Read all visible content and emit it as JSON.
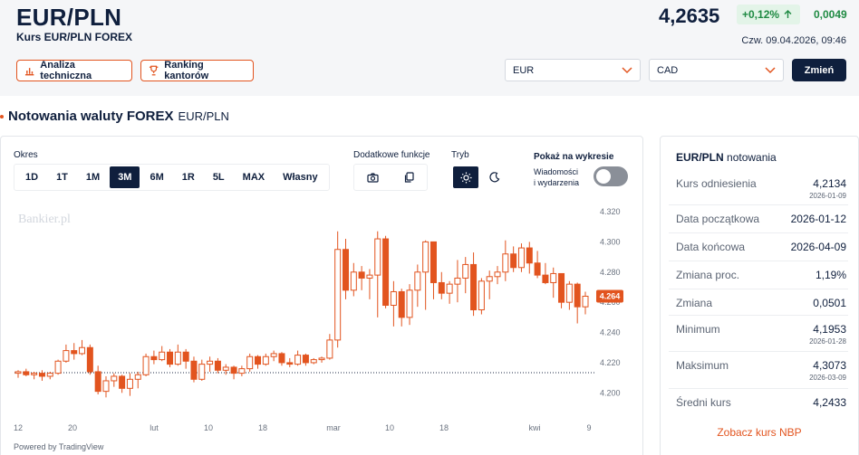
{
  "header": {
    "title": "EUR/PLN",
    "subtitle": "Kurs EUR/PLN FOREX",
    "rate": "4,2635",
    "change_pct": "+0,12%",
    "change_abs": "0,0049",
    "datetime": "Czw. 09.04.2026, 09:46",
    "buttons": {
      "analysis": "Analiza techniczna",
      "ranking": "Ranking kantorów",
      "change": "Zmień"
    },
    "select_from": "EUR",
    "select_to": "CAD",
    "colors": {
      "accent": "#e2541f",
      "navy": "#0f1f3d",
      "positive": "#1f8a43"
    }
  },
  "section": {
    "title": "Notowania waluty FOREX",
    "pair": "EUR/PLN"
  },
  "controls": {
    "okres_label": "Okres",
    "periods": [
      "1D",
      "1T",
      "1M",
      "3M",
      "6M",
      "1R",
      "5L",
      "MAX",
      "Własny"
    ],
    "active_period": "3M",
    "functions_label": "Dodatkowe funkcje",
    "functions": [
      "camera-icon",
      "copy-icon"
    ],
    "mode_label": "Tryb",
    "modes": [
      "sun-icon",
      "moon-icon"
    ],
    "show_label": "Pokaż na wykresie",
    "toggle_label_1": "Wiadomości",
    "toggle_label_2": "i wydarzenia",
    "toggle_on": false
  },
  "chart_data": {
    "type": "candlestick",
    "watermark": "Bankier.pl",
    "powered_by": "Powered by TradingView",
    "ylim": [
      4.193,
      4.326
    ],
    "y_ticks": [
      "4.320",
      "4.300",
      "4.280",
      "4.260",
      "4.240",
      "4.220",
      "4.200"
    ],
    "x_ticks": [
      "12",
      "20",
      "lut",
      "10",
      "18",
      "mar",
      "10",
      "18",
      "kwi",
      "9"
    ],
    "reference_line": 4.2134,
    "last_price_label": "4.264",
    "colors": {
      "up": "#e2541f",
      "down": "#e2541f",
      "label_bg": "#e2541f"
    },
    "candles": [
      {
        "o": 4.213,
        "h": 4.215,
        "l": 4.21,
        "c": 4.214
      },
      {
        "o": 4.214,
        "h": 4.216,
        "l": 4.211,
        "c": 4.212
      },
      {
        "o": 4.212,
        "h": 4.214,
        "l": 4.209,
        "c": 4.213
      },
      {
        "o": 4.213,
        "h": 4.215,
        "l": 4.208,
        "c": 4.211
      },
      {
        "o": 4.211,
        "h": 4.214,
        "l": 4.209,
        "c": 4.213
      },
      {
        "o": 4.213,
        "h": 4.222,
        "l": 4.212,
        "c": 4.221
      },
      {
        "o": 4.221,
        "h": 4.232,
        "l": 4.22,
        "c": 4.228
      },
      {
        "o": 4.228,
        "h": 4.233,
        "l": 4.222,
        "c": 4.226
      },
      {
        "o": 4.226,
        "h": 4.235,
        "l": 4.225,
        "c": 4.23
      },
      {
        "o": 4.23,
        "h": 4.232,
        "l": 4.212,
        "c": 4.214
      },
      {
        "o": 4.214,
        "h": 4.218,
        "l": 4.199,
        "c": 4.201
      },
      {
        "o": 4.201,
        "h": 4.211,
        "l": 4.197,
        "c": 4.208
      },
      {
        "o": 4.208,
        "h": 4.213,
        "l": 4.204,
        "c": 4.211
      },
      {
        "o": 4.211,
        "h": 4.212,
        "l": 4.2,
        "c": 4.203
      },
      {
        "o": 4.203,
        "h": 4.213,
        "l": 4.198,
        "c": 4.209
      },
      {
        "o": 4.209,
        "h": 4.214,
        "l": 4.203,
        "c": 4.212
      },
      {
        "o": 4.212,
        "h": 4.226,
        "l": 4.211,
        "c": 4.224
      },
      {
        "o": 4.224,
        "h": 4.228,
        "l": 4.219,
        "c": 4.222
      },
      {
        "o": 4.222,
        "h": 4.231,
        "l": 4.221,
        "c": 4.227
      },
      {
        "o": 4.227,
        "h": 4.229,
        "l": 4.217,
        "c": 4.219
      },
      {
        "o": 4.219,
        "h": 4.232,
        "l": 4.218,
        "c": 4.227
      },
      {
        "o": 4.227,
        "h": 4.229,
        "l": 4.216,
        "c": 4.221
      },
      {
        "o": 4.221,
        "h": 4.224,
        "l": 4.207,
        "c": 4.209
      },
      {
        "o": 4.209,
        "h": 4.222,
        "l": 4.208,
        "c": 4.219
      },
      {
        "o": 4.219,
        "h": 4.224,
        "l": 4.214,
        "c": 4.221
      },
      {
        "o": 4.221,
        "h": 4.223,
        "l": 4.213,
        "c": 4.215
      },
      {
        "o": 4.215,
        "h": 4.219,
        "l": 4.212,
        "c": 4.217
      },
      {
        "o": 4.217,
        "h": 4.218,
        "l": 4.209,
        "c": 4.213
      },
      {
        "o": 4.213,
        "h": 4.218,
        "l": 4.211,
        "c": 4.216
      },
      {
        "o": 4.216,
        "h": 4.226,
        "l": 4.214,
        "c": 4.224
      },
      {
        "o": 4.224,
        "h": 4.225,
        "l": 4.216,
        "c": 4.219
      },
      {
        "o": 4.219,
        "h": 4.226,
        "l": 4.218,
        "c": 4.224
      },
      {
        "o": 4.224,
        "h": 4.228,
        "l": 4.221,
        "c": 4.226
      },
      {
        "o": 4.226,
        "h": 4.227,
        "l": 4.218,
        "c": 4.22
      },
      {
        "o": 4.22,
        "h": 4.223,
        "l": 4.217,
        "c": 4.219
      },
      {
        "o": 4.219,
        "h": 4.228,
        "l": 4.218,
        "c": 4.225
      },
      {
        "o": 4.225,
        "h": 4.226,
        "l": 4.218,
        "c": 4.22
      },
      {
        "o": 4.22,
        "h": 4.223,
        "l": 4.219,
        "c": 4.222
      },
      {
        "o": 4.222,
        "h": 4.224,
        "l": 4.22,
        "c": 4.223
      },
      {
        "o": 4.223,
        "h": 4.239,
        "l": 4.222,
        "c": 4.235
      },
      {
        "o": 4.235,
        "h": 4.307,
        "l": 4.23,
        "c": 4.295
      },
      {
        "o": 4.295,
        "h": 4.302,
        "l": 4.262,
        "c": 4.268
      },
      {
        "o": 4.268,
        "h": 4.286,
        "l": 4.264,
        "c": 4.28
      },
      {
        "o": 4.28,
        "h": 4.284,
        "l": 4.268,
        "c": 4.276
      },
      {
        "o": 4.276,
        "h": 4.282,
        "l": 4.262,
        "c": 4.278
      },
      {
        "o": 4.278,
        "h": 4.307,
        "l": 4.25,
        "c": 4.302
      },
      {
        "o": 4.302,
        "h": 4.304,
        "l": 4.256,
        "c": 4.258
      },
      {
        "o": 4.258,
        "h": 4.274,
        "l": 4.244,
        "c": 4.267
      },
      {
        "o": 4.267,
        "h": 4.269,
        "l": 4.244,
        "c": 4.25
      },
      {
        "o": 4.25,
        "h": 4.272,
        "l": 4.245,
        "c": 4.268
      },
      {
        "o": 4.268,
        "h": 4.285,
        "l": 4.257,
        "c": 4.28
      },
      {
        "o": 4.28,
        "h": 4.301,
        "l": 4.255,
        "c": 4.3
      },
      {
        "o": 4.3,
        "h": 4.3,
        "l": 4.262,
        "c": 4.273
      },
      {
        "o": 4.273,
        "h": 4.28,
        "l": 4.262,
        "c": 4.266
      },
      {
        "o": 4.266,
        "h": 4.274,
        "l": 4.259,
        "c": 4.272
      },
      {
        "o": 4.272,
        "h": 4.288,
        "l": 4.26,
        "c": 4.276
      },
      {
        "o": 4.276,
        "h": 4.29,
        "l": 4.266,
        "c": 4.285
      },
      {
        "o": 4.285,
        "h": 4.293,
        "l": 4.251,
        "c": 4.255
      },
      {
        "o": 4.255,
        "h": 4.276,
        "l": 4.252,
        "c": 4.274
      },
      {
        "o": 4.274,
        "h": 4.281,
        "l": 4.262,
        "c": 4.277
      },
      {
        "o": 4.277,
        "h": 4.284,
        "l": 4.272,
        "c": 4.28
      },
      {
        "o": 4.28,
        "h": 4.301,
        "l": 4.274,
        "c": 4.292
      },
      {
        "o": 4.292,
        "h": 4.297,
        "l": 4.28,
        "c": 4.283
      },
      {
        "o": 4.283,
        "h": 4.299,
        "l": 4.28,
        "c": 4.296
      },
      {
        "o": 4.296,
        "h": 4.3,
        "l": 4.279,
        "c": 4.286
      },
      {
        "o": 4.286,
        "h": 4.294,
        "l": 4.276,
        "c": 4.278
      },
      {
        "o": 4.278,
        "h": 4.286,
        "l": 4.272,
        "c": 4.273
      },
      {
        "o": 4.273,
        "h": 4.283,
        "l": 4.263,
        "c": 4.279
      },
      {
        "o": 4.279,
        "h": 4.279,
        "l": 4.256,
        "c": 4.26
      },
      {
        "o": 4.26,
        "h": 4.274,
        "l": 4.255,
        "c": 4.272
      },
      {
        "o": 4.272,
        "h": 4.273,
        "l": 4.246,
        "c": 4.257
      },
      {
        "o": 4.257,
        "h": 4.267,
        "l": 4.252,
        "c": 4.264
      }
    ]
  },
  "sidebar": {
    "title_bold": "EUR/PLN",
    "title_rest": "notowania",
    "rows": [
      {
        "label": "Kurs odniesienia",
        "value": "4,2134",
        "date": "2026-01-09"
      },
      {
        "label": "Data początkowa",
        "value": "2026-01-12",
        "date": ""
      },
      {
        "label": "Data końcowa",
        "value": "2026-04-09",
        "date": ""
      },
      {
        "label": "Zmiana proc.",
        "value": "1,19%",
        "date": ""
      },
      {
        "label": "Zmiana",
        "value": "0,0501",
        "date": ""
      },
      {
        "label": "Minimum",
        "value": "4,1953",
        "date": "2026-01-28"
      },
      {
        "label": "Maksimum",
        "value": "4,3073",
        "date": "2026-03-09"
      },
      {
        "label": "Średni kurs",
        "value": "4,2433",
        "date": ""
      }
    ],
    "nbp_link": "Zobacz kurs NBP"
  }
}
